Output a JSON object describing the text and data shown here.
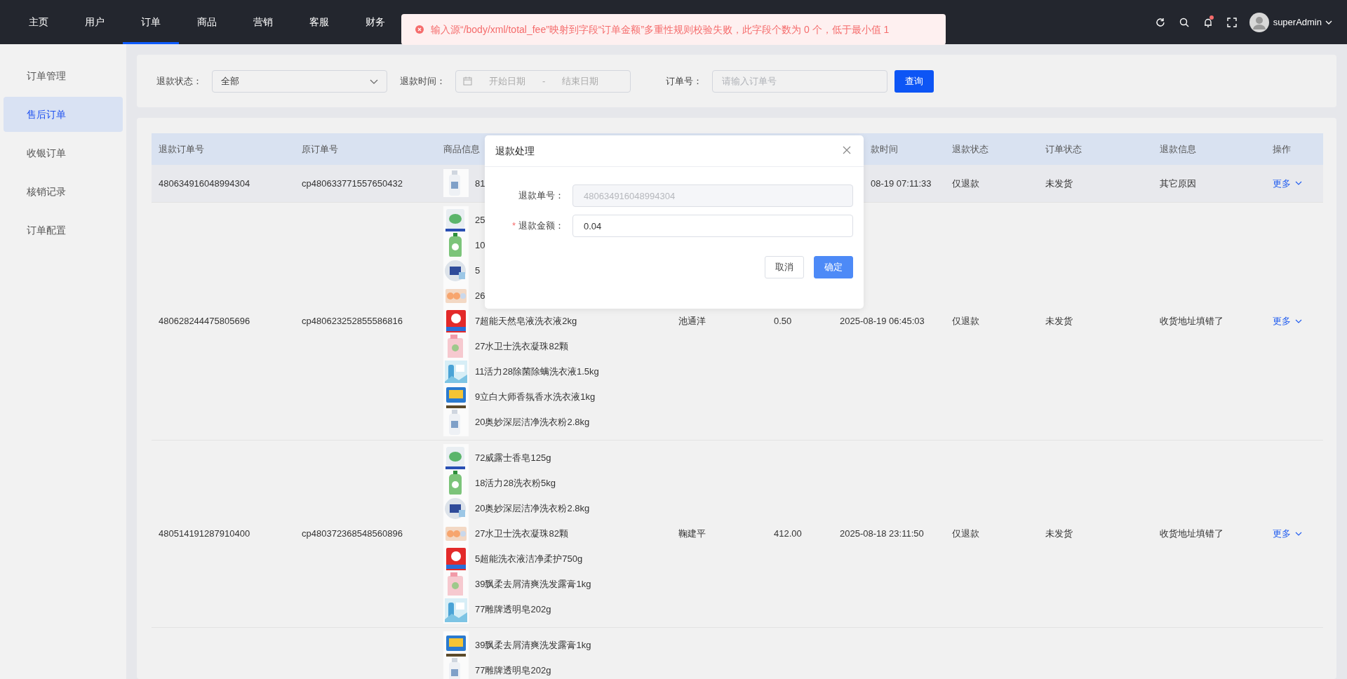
{
  "top_nav": {
    "items": [
      {
        "label": "主页",
        "selected": false
      },
      {
        "label": "用户",
        "selected": false
      },
      {
        "label": "订单",
        "selected": true
      },
      {
        "label": "商品",
        "selected": false
      },
      {
        "label": "营销",
        "selected": false
      },
      {
        "label": "客服",
        "selected": false
      },
      {
        "label": "财务",
        "selected": false
      }
    ],
    "notification": {
      "unread": true
    },
    "user": {
      "name": "superAdmin"
    }
  },
  "toast": {
    "kind": "error",
    "text": "输入源“/body/xml/total_fee”映射到字段“订单金额”多重性规则校验失败，此字段个数为 0 个，低于最小值 1"
  },
  "sidebar": {
    "items": [
      {
        "label": "订单管理",
        "selected": false
      },
      {
        "label": "售后订单",
        "selected": true
      },
      {
        "label": "收银订单",
        "selected": false
      },
      {
        "label": "核销记录",
        "selected": false
      },
      {
        "label": "订单配置",
        "selected": false
      }
    ]
  },
  "filters": {
    "refund_status": {
      "label": "退款状态：",
      "value": "全部"
    },
    "refund_time": {
      "label": "退款时间：",
      "start_placeholder": "开始日期",
      "separator": "-",
      "end_placeholder": "结束日期"
    },
    "order_no": {
      "label": "订单号：",
      "placeholder": "请输入订单号"
    },
    "search_button": "查询"
  },
  "table": {
    "columns": [
      "退款订单号",
      "原订单号",
      "商品信息",
      null,
      null,
      "款时间",
      "退款状态",
      "订单状态",
      "退款信息",
      "操作"
    ],
    "rows": [
      {
        "hovered": true,
        "refund_no": "480634916048994304",
        "order_no": "cp480633771557650432",
        "products": [
          {
            "name": "81"
          }
        ],
        "refund_time": "08-19 07:11:33",
        "refund_status": "仅退款",
        "order_status": "未发货",
        "refund_info": "其它原因",
        "action": "更多"
      },
      {
        "hovered": false,
        "refund_no": "480628244475805696",
        "order_no": "cp480623252855586816",
        "products": [
          {
            "name": "25"
          },
          {
            "name": "10"
          },
          {
            "name": "5"
          },
          {
            "name": "26"
          },
          {
            "name": "7超能天然皂液洗衣液2kg"
          },
          {
            "name": "27水卫士洗衣凝珠82颗"
          },
          {
            "name": "11活力28除菌除螨洗衣液1.5kg"
          },
          {
            "name": "9立白大师香氛香水洗衣液1kg"
          },
          {
            "name": "20奥妙深层洁净洗衣粉2.8kg"
          }
        ],
        "column_4": "池通洋",
        "column_5": "0.50",
        "refund_time": "2025-08-19 06:45:03",
        "refund_status": "仅退款",
        "order_status": "未发货",
        "refund_info": "收货地址填错了",
        "action": "更多"
      },
      {
        "hovered": false,
        "refund_no": "480514191287910400",
        "order_no": "cp480372368548560896",
        "products": [
          {
            "name": "72威露士香皂125g"
          },
          {
            "name": "18活力28洗衣粉5kg"
          },
          {
            "name": "20奥妙深层洁净洗衣粉2.8kg"
          },
          {
            "name": "27水卫士洗衣凝珠82颗"
          },
          {
            "name": "5超能洗衣液洁净柔护750g"
          },
          {
            "name": "39飘柔去屑清爽洗发露膏1kg"
          },
          {
            "name": "77雕牌透明皂202g"
          }
        ],
        "column_4": "鞠建平",
        "column_5": "412.00",
        "refund_time": "2025-08-18 23:11:50",
        "refund_status": "仅退款",
        "order_status": "未发货",
        "refund_info": "收货地址填错了",
        "action": "更多"
      },
      {
        "hovered": false,
        "products": [
          {
            "name": "39飘柔去屑清爽洗发露膏1kg"
          },
          {
            "name": "77雕牌透明皂202g"
          }
        ]
      }
    ]
  },
  "dialog": {
    "title": "退款处理",
    "fields": [
      {
        "label": "退款单号：",
        "value": "480634916048994304",
        "disabled": true
      },
      {
        "label": "退款金额：",
        "value": "0.04",
        "disabled": false,
        "required_mark": "*"
      }
    ],
    "buttons": [
      {
        "label": "取消",
        "kind": "default"
      },
      {
        "label": "确定",
        "kind": "primary"
      }
    ]
  }
}
